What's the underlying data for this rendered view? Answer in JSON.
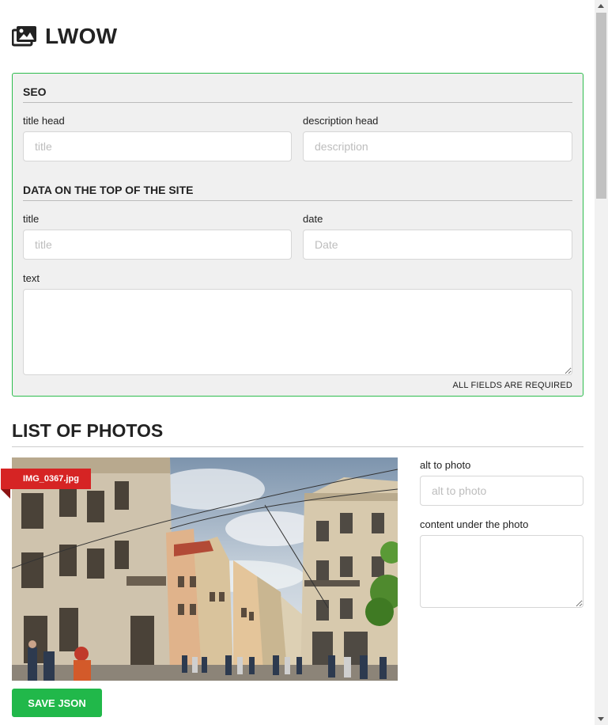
{
  "header": {
    "title": "LWOW",
    "icon": "images-icon"
  },
  "seo": {
    "heading": "SEO",
    "title_head": {
      "label": "title head",
      "placeholder": "title",
      "value": ""
    },
    "description_head": {
      "label": "description head",
      "placeholder": "description",
      "value": ""
    }
  },
  "top_data": {
    "heading": "DATA ON THE TOP OF THE SITE",
    "title": {
      "label": "title",
      "placeholder": "title",
      "value": ""
    },
    "date": {
      "label": "date",
      "placeholder": "Date",
      "value": ""
    },
    "text": {
      "label": "text",
      "value": ""
    }
  },
  "required_note": "ALL FIELDS ARE REQUIRED",
  "photos": {
    "heading": "LIST OF PHOTOS",
    "items": [
      {
        "filename": "IMG_0367.jpg",
        "alt_label": "alt to photo",
        "alt_placeholder": "alt to photo",
        "content_label": "content under the photo"
      }
    ]
  },
  "save_button": "SAVE JSON",
  "colors": {
    "accent_green": "#21b84a",
    "card_border": "#2ebd4e",
    "ribbon_red": "#d62424"
  }
}
